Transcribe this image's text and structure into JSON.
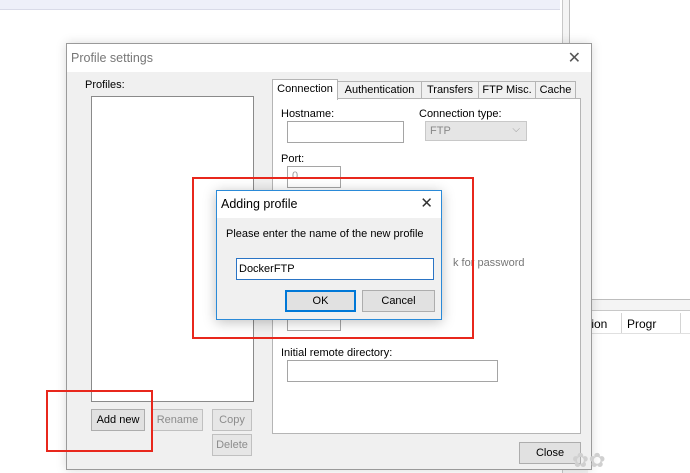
{
  "background": {
    "columns": [
      "tion",
      "Progr"
    ]
  },
  "profile_window": {
    "title": "Profile settings",
    "profiles_label": "Profiles:",
    "buttons": {
      "add_new": "Add new",
      "rename": "Rename",
      "copy": "Copy",
      "delete": "Delete",
      "close": "Close"
    },
    "tabs": [
      "Connection",
      "Authentication",
      "Transfers",
      "FTP Misc.",
      "Cache"
    ],
    "active_tab": "Connection",
    "connection": {
      "hostname_label": "Hostname:",
      "hostname_value": "",
      "connection_type_label": "Connection type:",
      "connection_type_value": "FTP",
      "port_label": "Port:",
      "port_value": "0",
      "ask_password_partial": "k for password",
      "initial_dir_label": "Initial remote directory:",
      "initial_dir_value": ""
    }
  },
  "add_dialog": {
    "title": "Adding profile",
    "prompt": "Please enter the name of the new profile",
    "input_value": "DockerFTP",
    "ok": "OK",
    "cancel": "Cancel"
  },
  "colors": {
    "highlight": "#e8271c",
    "dialog_border": "#2a8ad8"
  },
  "icons": {
    "close": "close-icon",
    "dropdown": "chevron-down-icon"
  }
}
